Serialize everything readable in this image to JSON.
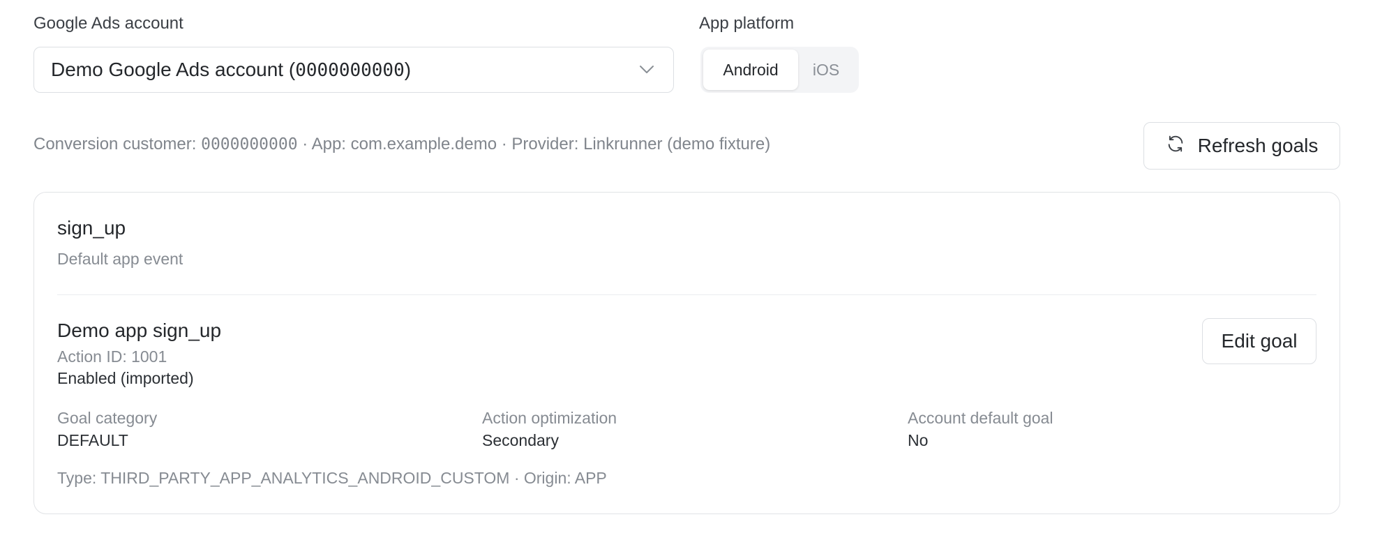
{
  "account": {
    "label": "Google Ads account",
    "selected_name": "Demo Google Ads account (",
    "selected_id": "0000000000",
    "selected_suffix": ")",
    "chevron_icon": "chevron-down-icon"
  },
  "platform": {
    "label": "App platform",
    "options": [
      "Android",
      "iOS"
    ],
    "selected": "Android"
  },
  "meta": {
    "customer_label": "Conversion customer: ",
    "customer_id": "0000000000",
    "rest": " · App: com.example.demo · Provider: Linkrunner (demo fixture)"
  },
  "refresh": {
    "label": "Refresh goals",
    "icon": "refresh-icon"
  },
  "event": {
    "name": "sign_up",
    "subtitle": "Default app event"
  },
  "goal": {
    "name": "Demo app sign_up",
    "action_id": "Action ID: 1001",
    "status": "Enabled (imported)",
    "edit_label": "Edit goal",
    "fields": [
      {
        "label": "Goal category",
        "value": "DEFAULT"
      },
      {
        "label": "Action optimization",
        "value": "Secondary"
      },
      {
        "label": "Account default goal",
        "value": "No"
      }
    ],
    "type_line": "Type: THIRD_PARTY_APP_ANALYTICS_ANDROID_CUSTOM · Origin: APP"
  },
  "colors": {
    "border": "#dcdfe3",
    "muted_text": "#868b92",
    "primary_text": "#24272b",
    "segment_bg": "#f3f4f6"
  }
}
